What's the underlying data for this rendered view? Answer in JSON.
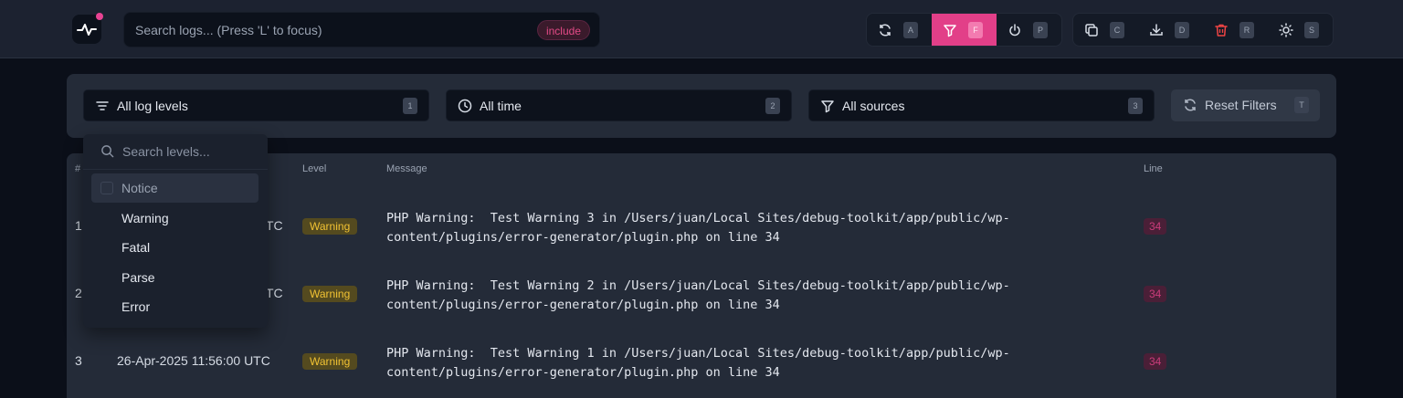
{
  "header": {
    "search_placeholder": "Search logs... (Press 'L' to focus)",
    "include_badge": "include",
    "toolbar": [
      {
        "icon": "refresh-icon",
        "key": "A"
      },
      {
        "icon": "filter-icon",
        "key": "F",
        "active": true
      },
      {
        "icon": "power-icon",
        "key": "P"
      },
      {
        "icon": "copy-icon",
        "key": "C"
      },
      {
        "icon": "download-icon",
        "key": "D"
      },
      {
        "icon": "trash-icon",
        "key": "R"
      },
      {
        "icon": "sun-icon",
        "key": "S"
      }
    ]
  },
  "filters": {
    "levels": {
      "label": "All log levels",
      "key": "1"
    },
    "time": {
      "label": "All time",
      "key": "2"
    },
    "sources": {
      "label": "All sources",
      "key": "3"
    },
    "reset": {
      "label": "Reset Filters",
      "key": "T"
    }
  },
  "dropdown": {
    "search_placeholder": "Search levels...",
    "items": [
      "Notice",
      "Warning",
      "Fatal",
      "Parse",
      "Error"
    ]
  },
  "table": {
    "headers": {
      "num": "#",
      "level": "Level",
      "message": "Message",
      "line": "Line"
    },
    "rows": [
      {
        "num": "1",
        "date": "TC",
        "level": "Warning",
        "message": "PHP Warning:  Test Warning 3 in /Users/juan/Local Sites/debug-toolkit/app/public/wp-\ncontent/plugins/error-generator/plugin.php on line 34",
        "line": "34"
      },
      {
        "num": "2",
        "date": "TC",
        "level": "Warning",
        "message": "PHP Warning:  Test Warning 2 in /Users/juan/Local Sites/debug-toolkit/app/public/wp-\ncontent/plugins/error-generator/plugin.php on line 34",
        "line": "34"
      },
      {
        "num": "3",
        "date": "26-Apr-2025 11:56:00 UTC",
        "level": "Warning",
        "message": "PHP Warning:  Test Warning 1 in /Users/juan/Local Sites/debug-toolkit/app/public/wp-\ncontent/plugins/error-generator/plugin.php on line 34",
        "line": "34"
      }
    ]
  },
  "colors": {
    "accent": "#e23f88",
    "warning": "#f1c233",
    "background": "#0b0f19"
  }
}
